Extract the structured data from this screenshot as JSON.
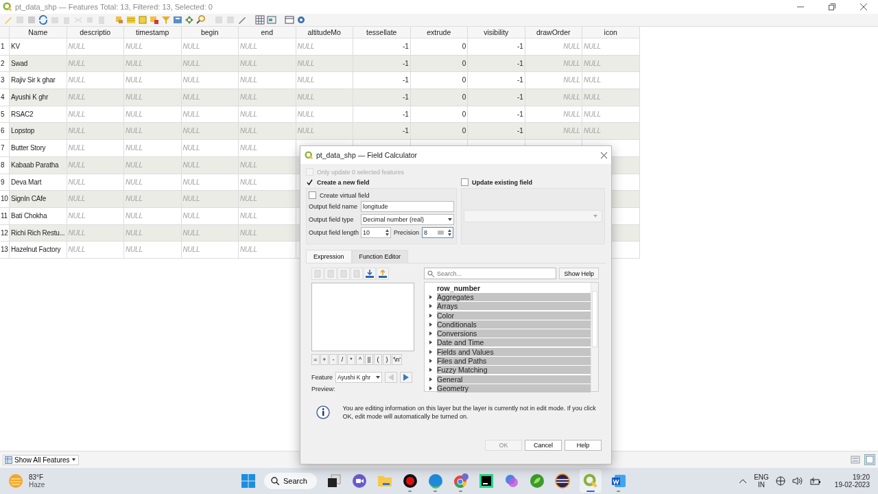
{
  "window": {
    "title": "pt_data_shp — Features Total: 13, Filtered: 13, Selected: 0"
  },
  "table": {
    "columns": [
      {
        "label": "Name",
        "kind": "text"
      },
      {
        "label": "descriptio",
        "kind": "null"
      },
      {
        "label": "timestamp",
        "kind": "null"
      },
      {
        "label": "begin",
        "kind": "null"
      },
      {
        "label": "end",
        "kind": "null"
      },
      {
        "label": "altitudeMo",
        "kind": "null"
      },
      {
        "label": "tessellate",
        "kind": "number"
      },
      {
        "label": "extrude",
        "kind": "number"
      },
      {
        "label": "visibility",
        "kind": "number"
      },
      {
        "label": "drawOrder",
        "kind": "null_number"
      },
      {
        "label": "icon",
        "kind": "null"
      }
    ],
    "rows": [
      {
        "number": "1",
        "cells": [
          "KV",
          "NULL",
          "NULL",
          "NULL",
          "NULL",
          "NULL",
          "-1",
          "0",
          "-1",
          "NULL",
          "NULL"
        ]
      },
      {
        "number": "2",
        "cells": [
          "Swad",
          "NULL",
          "NULL",
          "NULL",
          "NULL",
          "NULL",
          "-1",
          "0",
          "-1",
          "NULL",
          "NULL"
        ]
      },
      {
        "number": "3",
        "cells": [
          "Rajiv Sir k ghar",
          "NULL",
          "NULL",
          "NULL",
          "NULL",
          "NULL",
          "-1",
          "0",
          "-1",
          "NULL",
          "NULL"
        ]
      },
      {
        "number": "4",
        "cells": [
          "Ayushi K ghr",
          "NULL",
          "NULL",
          "NULL",
          "NULL",
          "NULL",
          "-1",
          "0",
          "-1",
          "NULL",
          "NULL"
        ]
      },
      {
        "number": "5",
        "cells": [
          "RSAC2",
          "NULL",
          "NULL",
          "NULL",
          "NULL",
          "NULL",
          "-1",
          "0",
          "-1",
          "NULL",
          "NULL"
        ]
      },
      {
        "number": "6",
        "cells": [
          "Lopstop",
          "NULL",
          "NULL",
          "NULL",
          "NULL",
          "NULL",
          "-1",
          "0",
          "-1",
          "NULL",
          "NULL"
        ]
      },
      {
        "number": "7",
        "cells": [
          "Butter Story",
          "NULL",
          "NULL",
          "NULL",
          "NULL"
        ]
      },
      {
        "number": "8",
        "cells": [
          "Kabaab Paratha",
          "NULL",
          "NULL",
          "NULL",
          "NULL"
        ]
      },
      {
        "number": "9",
        "cells": [
          "Deva Mart",
          "NULL",
          "NULL",
          "NULL",
          "NULL"
        ]
      },
      {
        "number": "10",
        "cells": [
          "SignIn CAfe",
          "NULL",
          "NULL",
          "NULL",
          "NULL"
        ]
      },
      {
        "number": "11",
        "cells": [
          "Bati Chokha",
          "NULL",
          "NULL",
          "NULL",
          "NULL"
        ]
      },
      {
        "number": "12",
        "cells": [
          "Richi Rich Restu...",
          "NULL",
          "NULL",
          "NULL",
          "NULL"
        ]
      },
      {
        "number": "13",
        "cells": [
          "Hazelnut Factory",
          "NULL",
          "NULL",
          "NULL",
          "NULL"
        ]
      }
    ]
  },
  "bottom_bar": {
    "filter_button": "Show All Features"
  },
  "dialog": {
    "title": "pt_data_shp — Field Calculator",
    "only_update": {
      "label": "Only update 0 selected features",
      "checked": false,
      "disabled": true
    },
    "create_new": {
      "label": "Create a new field",
      "checked": true
    },
    "create_virtual": {
      "label": "Create virtual field",
      "checked": false
    },
    "output_name": {
      "label": "Output field name",
      "value": "longitude"
    },
    "output_type": {
      "label": "Output field type",
      "value": "Decimal number (real)"
    },
    "output_length": {
      "label": "Output field length",
      "value": "10"
    },
    "precision": {
      "label": "Precision",
      "value": "8"
    },
    "update_existing": {
      "label": "Update existing field",
      "checked": false
    },
    "tabs": [
      {
        "label": "Expression",
        "selected": true
      },
      {
        "label": "Function Editor",
        "selected": false
      }
    ],
    "operators": [
      "=",
      "+",
      "-",
      "/",
      "*",
      "^",
      "||",
      "(",
      ")",
      "'\\n'"
    ],
    "feature": {
      "label": "Feature",
      "value": "Ayushi K ghr"
    },
    "preview_label": "Preview:",
    "search": {
      "placeholder": "Search..."
    },
    "show_help": "Show Help",
    "tree": [
      {
        "label": "row_number",
        "kind": "function",
        "selected": false
      },
      {
        "label": "Aggregates",
        "kind": "group",
        "selected": true
      },
      {
        "label": "Arrays",
        "kind": "group",
        "selected": true
      },
      {
        "label": "Color",
        "kind": "group",
        "selected": true
      },
      {
        "label": "Conditionals",
        "kind": "group",
        "selected": true
      },
      {
        "label": "Conversions",
        "kind": "group",
        "selected": true
      },
      {
        "label": "Date and Time",
        "kind": "group",
        "selected": true
      },
      {
        "label": "Fields and Values",
        "kind": "group",
        "selected": true
      },
      {
        "label": "Files and Paths",
        "kind": "group",
        "selected": true
      },
      {
        "label": "Fuzzy Matching",
        "kind": "group",
        "selected": true
      },
      {
        "label": "General",
        "kind": "group",
        "selected": true
      },
      {
        "label": "Geometry",
        "kind": "group",
        "selected": true
      }
    ],
    "message": "You are editing information on this layer but the layer is currently not in edit mode. If you click OK, edit mode will automatically be turned on.",
    "buttons": [
      {
        "label": "OK",
        "disabled": true
      },
      {
        "label": "Cancel",
        "disabled": false
      },
      {
        "label": "Help",
        "disabled": false
      }
    ]
  },
  "taskbar": {
    "temperature": "83°F",
    "weather": "Haze",
    "search": "Search",
    "apps": [
      {
        "kind": "taskview",
        "running": false,
        "active": false
      },
      {
        "kind": "meet",
        "running": false,
        "active": false
      },
      {
        "kind": "folder",
        "running": false,
        "active": false
      },
      {
        "kind": "recorder",
        "running": true,
        "active": false
      },
      {
        "kind": "edge",
        "running": true,
        "active": false
      },
      {
        "kind": "chrome",
        "running": true,
        "active": false
      },
      {
        "kind": "pycharm",
        "running": false,
        "active": false
      },
      {
        "kind": "copilot",
        "running": false,
        "active": false
      },
      {
        "kind": "leaf",
        "running": false,
        "active": false
      },
      {
        "kind": "eclipse",
        "running": false,
        "active": false
      },
      {
        "kind": "qgis",
        "running": true,
        "active": true
      },
      {
        "kind": "word",
        "running": true,
        "active": false
      }
    ],
    "language": "ENG",
    "region": "IN",
    "time": "19:20",
    "date": "19-02-2023"
  }
}
